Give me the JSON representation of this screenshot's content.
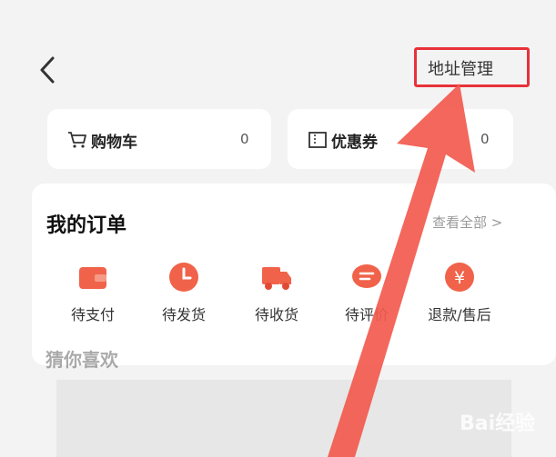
{
  "header": {
    "address_label": "地址管理"
  },
  "cards": [
    {
      "label": "购物车",
      "count": "0",
      "icon": "cart-icon"
    },
    {
      "label": "优惠券",
      "count": "0",
      "icon": "coupon-icon"
    }
  ],
  "orders": {
    "title": "我的订单",
    "view_all": "查看全部 >",
    "statuses": [
      {
        "label": "待支付",
        "icon": "wallet-icon"
      },
      {
        "label": "待发货",
        "icon": "clock-icon"
      },
      {
        "label": "待收货",
        "icon": "truck-icon"
      },
      {
        "label": "待评价",
        "icon": "comment-icon"
      },
      {
        "label": "退款/售后",
        "icon": "yen-icon"
      }
    ]
  },
  "guess_title": "猜你喜欢",
  "watermark": "Bai经验",
  "colors": {
    "accent": "#f0634a",
    "highlight": "#e8313a",
    "arrow": "#f25a4e"
  }
}
